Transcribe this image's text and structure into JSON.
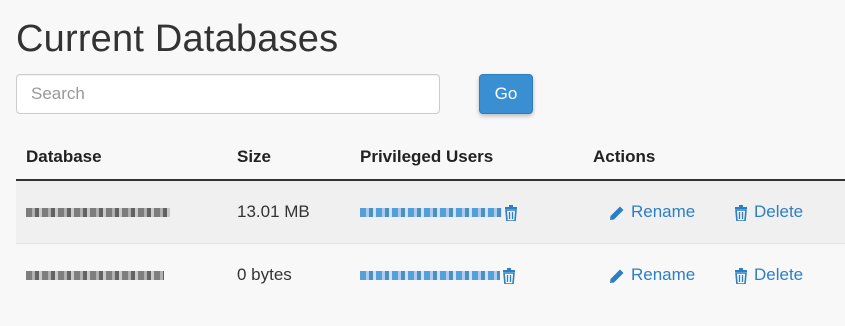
{
  "page": {
    "title": "Current Databases"
  },
  "search": {
    "placeholder": "Search",
    "value": "",
    "go_label": "Go"
  },
  "table": {
    "headers": {
      "database": "Database",
      "size": "Size",
      "users": "Privileged Users",
      "actions": "Actions"
    },
    "rows": [
      {
        "size": "13.01 MB",
        "rename_label": "Rename",
        "delete_label": "Delete"
      },
      {
        "size": "0 bytes",
        "rename_label": "Rename",
        "delete_label": "Delete"
      }
    ]
  },
  "colors": {
    "accent": "#3a8fd3",
    "link": "#2c7fc4",
    "text": "#333333",
    "background": "#f8f8f8"
  },
  "icons": {
    "edit": "pencil-icon",
    "delete": "trash-icon"
  }
}
